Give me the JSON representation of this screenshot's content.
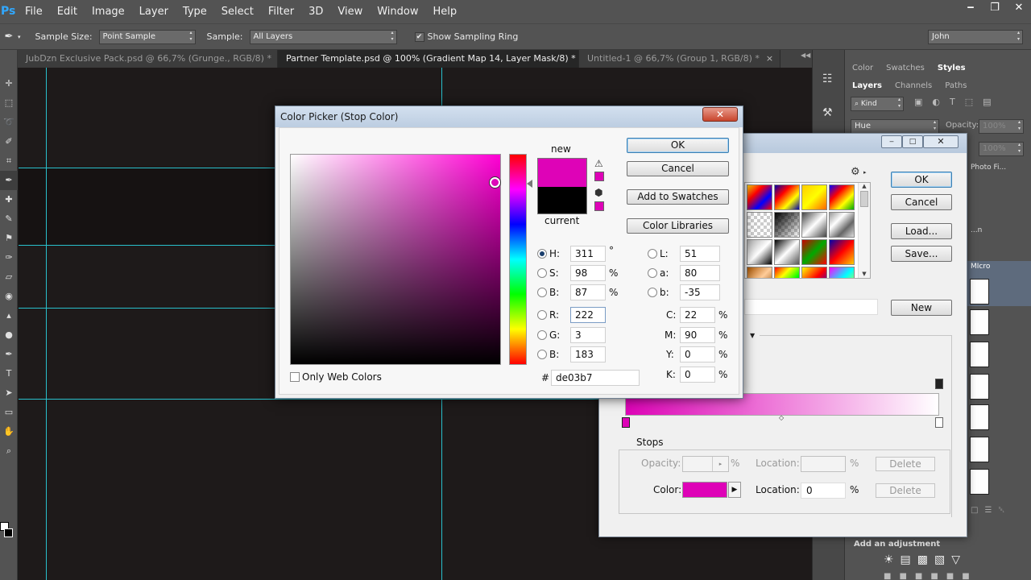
{
  "app": {
    "logo": "Ps"
  },
  "menu": [
    "File",
    "Edit",
    "Image",
    "Layer",
    "Type",
    "Select",
    "Filter",
    "3D",
    "View",
    "Window",
    "Help"
  ],
  "window_controls": {
    "minimize": "‒",
    "restore": "❐",
    "close": "✕"
  },
  "options": {
    "sample_size_label": "Sample Size:",
    "sample_size_value": "Point Sample",
    "sample_label": "Sample:",
    "sample_value": "All Layers",
    "sampling_ring_label": "Show Sampling Ring",
    "workspace": "John"
  },
  "tabs": [
    {
      "label": "JubDzn Exclusive Pack.psd @ 66,7% (Grunge., RGB/8) *"
    },
    {
      "label": "Partner Template.psd @ 100% (Gradient Map 14, Layer Mask/8) *"
    },
    {
      "label": "Untitled-1 @ 66,7% (Group 1, RGB/8) *"
    }
  ],
  "right_panel": {
    "top_tabs": [
      "Color",
      "Swatches",
      "Styles"
    ],
    "layer_tabs": [
      "Layers",
      "Channels",
      "Paths"
    ],
    "kind_label": "Kind",
    "blend_mode": "Hue",
    "opacity_label": "Opacity:",
    "opacity_value": "100%",
    "fill_value": "100%",
    "layer_names": [
      "Photo Fi...",
      "...n",
      "MIcro"
    ],
    "footer": "Add an adjustment"
  },
  "gradient_editor": {
    "ok": "OK",
    "cancel": "Cancel",
    "load": "Load...",
    "save": "Save...",
    "new": "New",
    "stops_label": "Stops",
    "opacity_label": "Opacity:",
    "opacity_unit": "%",
    "location_label": "Location:",
    "location_unit": "%",
    "delete": "Delete",
    "color_label": "Color:",
    "color_location_value": "0",
    "stop_color": "#de03b7"
  },
  "color_picker": {
    "title": "Color Picker (Stop Color)",
    "new_label": "new",
    "current_label": "current",
    "ok": "OK",
    "cancel": "Cancel",
    "add_to_swatches": "Add to Swatches",
    "color_libraries": "Color Libraries",
    "only_web_colors": "Only Web Colors",
    "new_color": "#de03b7",
    "current_color": "#000000",
    "fields": {
      "H": {
        "label": "H:",
        "value": "311",
        "unit": "°"
      },
      "S": {
        "label": "S:",
        "value": "98",
        "unit": "%"
      },
      "B": {
        "label": "B:",
        "value": "87",
        "unit": "%"
      },
      "R": {
        "label": "R:",
        "value": "222"
      },
      "G": {
        "label": "G:",
        "value": "3"
      },
      "Bl": {
        "label": "B:",
        "value": "183"
      },
      "L": {
        "label": "L:",
        "value": "51"
      },
      "a": {
        "label": "a:",
        "value": "80"
      },
      "b": {
        "label": "b:",
        "value": "-35"
      },
      "C": {
        "label": "C:",
        "value": "22",
        "unit": "%"
      },
      "M": {
        "label": "M:",
        "value": "90",
        "unit": "%"
      },
      "Y": {
        "label": "Y:",
        "value": "0",
        "unit": "%"
      },
      "K": {
        "label": "K:",
        "value": "0",
        "unit": "%"
      }
    },
    "hash": "#",
    "hex": "de03b7"
  }
}
